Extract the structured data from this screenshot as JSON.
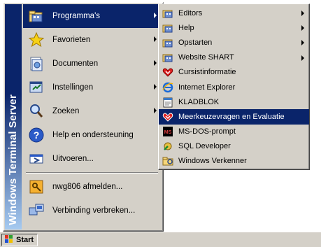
{
  "banner": {
    "text": "Windows Terminal Server"
  },
  "start_menu": {
    "items": [
      {
        "label": "Programma's",
        "icon": "programs-folder-icon",
        "submenu": true,
        "selected": true
      },
      {
        "label": "Favorieten",
        "icon": "favorites-star-icon",
        "submenu": true
      },
      {
        "label": "Documenten",
        "icon": "documents-icon",
        "submenu": true
      },
      {
        "label": "Instellingen",
        "icon": "settings-icon",
        "submenu": true
      },
      {
        "label": "Zoeken",
        "icon": "search-icon",
        "submenu": true
      },
      {
        "label": "Help en ondersteuning",
        "icon": "help-icon",
        "submenu": false
      },
      {
        "label": "Uitvoeren...",
        "icon": "run-icon",
        "submenu": false
      },
      {
        "label": "nwg806 afmelden...",
        "icon": "logoff-key-icon",
        "submenu": false
      },
      {
        "label": "Verbinding verbreken...",
        "icon": "disconnect-icon",
        "submenu": false
      }
    ]
  },
  "submenu": {
    "items": [
      {
        "label": "Editors",
        "icon": "program-group-icon",
        "submenu": true
      },
      {
        "label": "Help",
        "icon": "program-group-icon",
        "submenu": true
      },
      {
        "label": "Opstarten",
        "icon": "program-group-icon",
        "submenu": true
      },
      {
        "label": "Website SHART",
        "icon": "program-group-icon",
        "submenu": true
      },
      {
        "label": "Cursistinformatie",
        "icon": "app-heart-icon",
        "submenu": false
      },
      {
        "label": "Internet Explorer",
        "icon": "internet-explorer-icon",
        "submenu": false
      },
      {
        "label": "KLADBLOK",
        "icon": "notepad-icon",
        "submenu": false
      },
      {
        "label": "Meerkeuzevragen en Evaluatie",
        "icon": "app-heart-icon",
        "submenu": false,
        "selected": true
      },
      {
        "label": "MS-DOS-prompt",
        "icon": "msdos-icon",
        "submenu": false
      },
      {
        "label": "SQL Developer",
        "icon": "sql-developer-icon",
        "submenu": false
      },
      {
        "label": "Windows Verkenner",
        "icon": "explorer-folder-icon",
        "submenu": false
      }
    ]
  },
  "taskbar": {
    "start_label": "Start"
  },
  "colors": {
    "highlight": "#0a246a",
    "face": "#d4d0c8"
  }
}
